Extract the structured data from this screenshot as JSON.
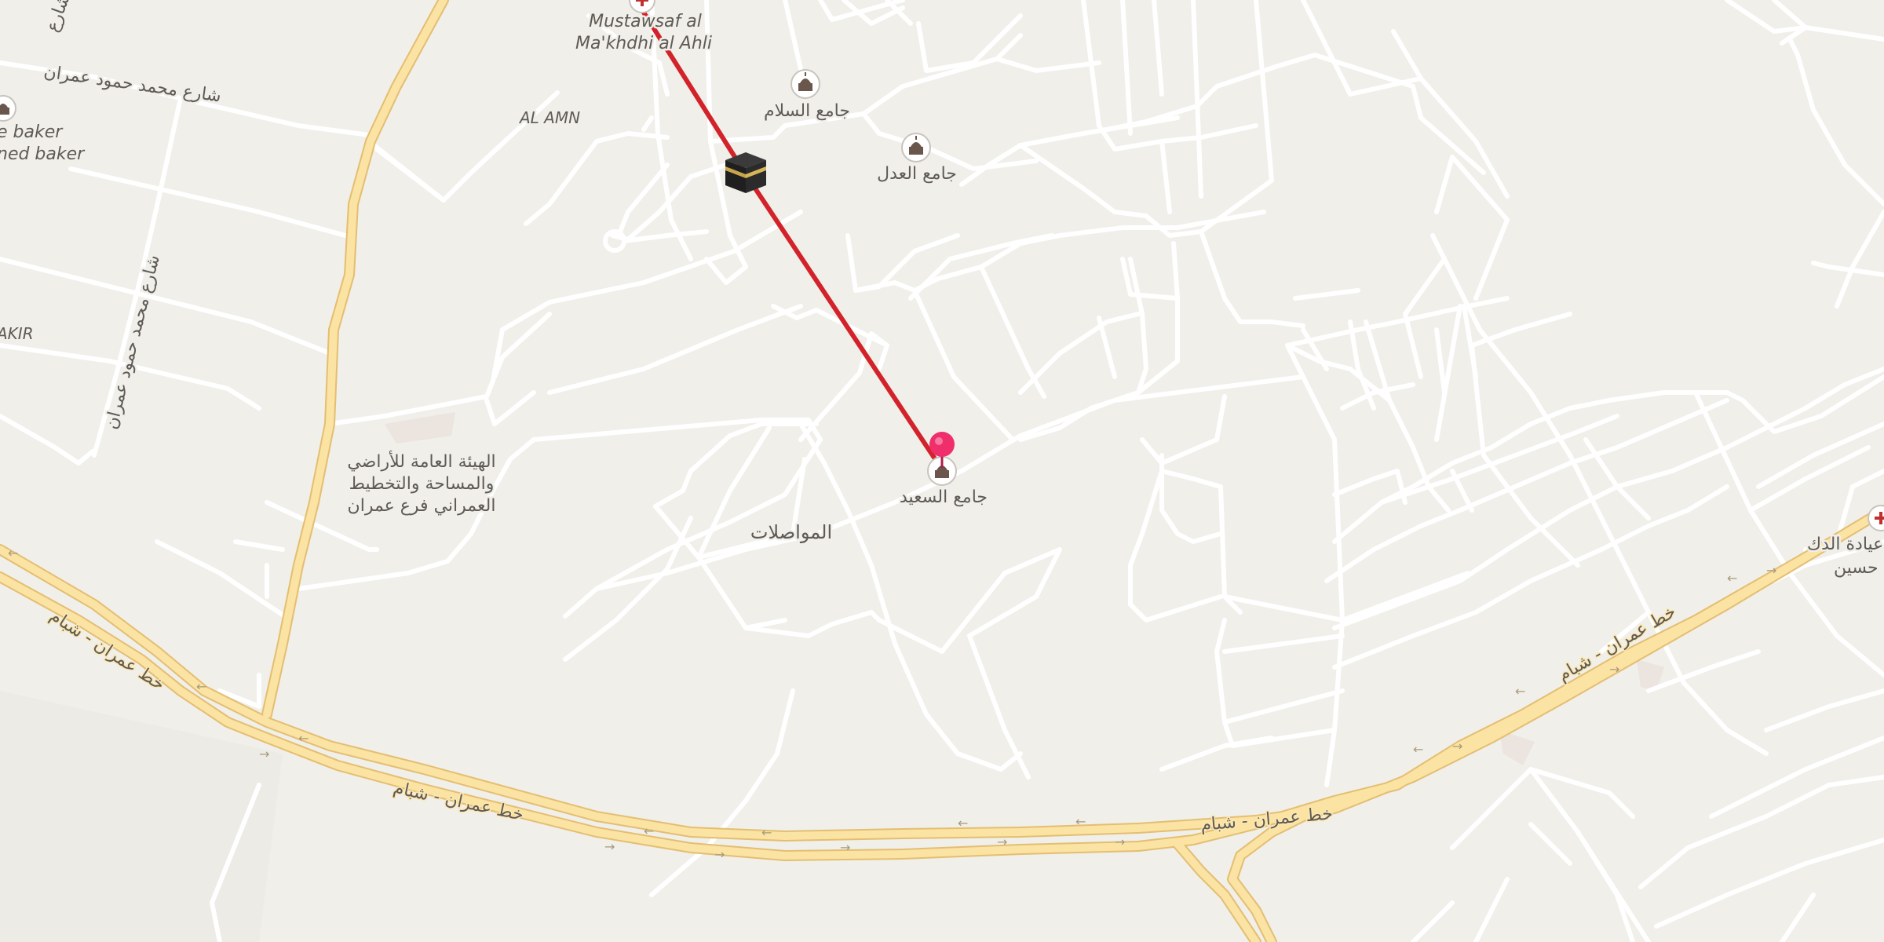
{
  "map": {
    "colors": {
      "land": "#f0efea",
      "street": "#ffffff",
      "highway": "#fbe3a3",
      "highway_casing": "#e4be71",
      "route": "#d2232a",
      "pin": "#ef2e6b"
    },
    "labels": {
      "mustawsaf_line1": "Mustawsaf al",
      "mustawsaf_line2": "Ma'khdhi al Ahli",
      "mosque_salam": "جامع السلام",
      "mosque_adl": "جامع العدل",
      "mosque_saeed": "جامع السعيد",
      "al_amn": "AL AMN",
      "road_mohammed_left": "شارع محمد حمود عمران",
      "road_mohammed_vertical": "شارع محمد حمود عمران",
      "road_top_left_vertical": "شارع",
      "baker_line1": "e baker",
      "baker_line2": "ned baker",
      "akir": "AKIR",
      "authority_line1": "الهيئة العامة للأراضي",
      "authority_line2": "والمساحة والتخطيط",
      "authority_line3": "العمراني فرع عمران",
      "transport": "المواصلات",
      "clinic_line1": "عيادة الدك",
      "clinic_line2": "حسين",
      "highway_name": "خط عمران - شبام"
    },
    "icons": {
      "kaaba": "kaaba-icon",
      "mosque": "mosque-icon",
      "pin": "location-pin-icon",
      "medical": "medical-cross-icon"
    }
  }
}
